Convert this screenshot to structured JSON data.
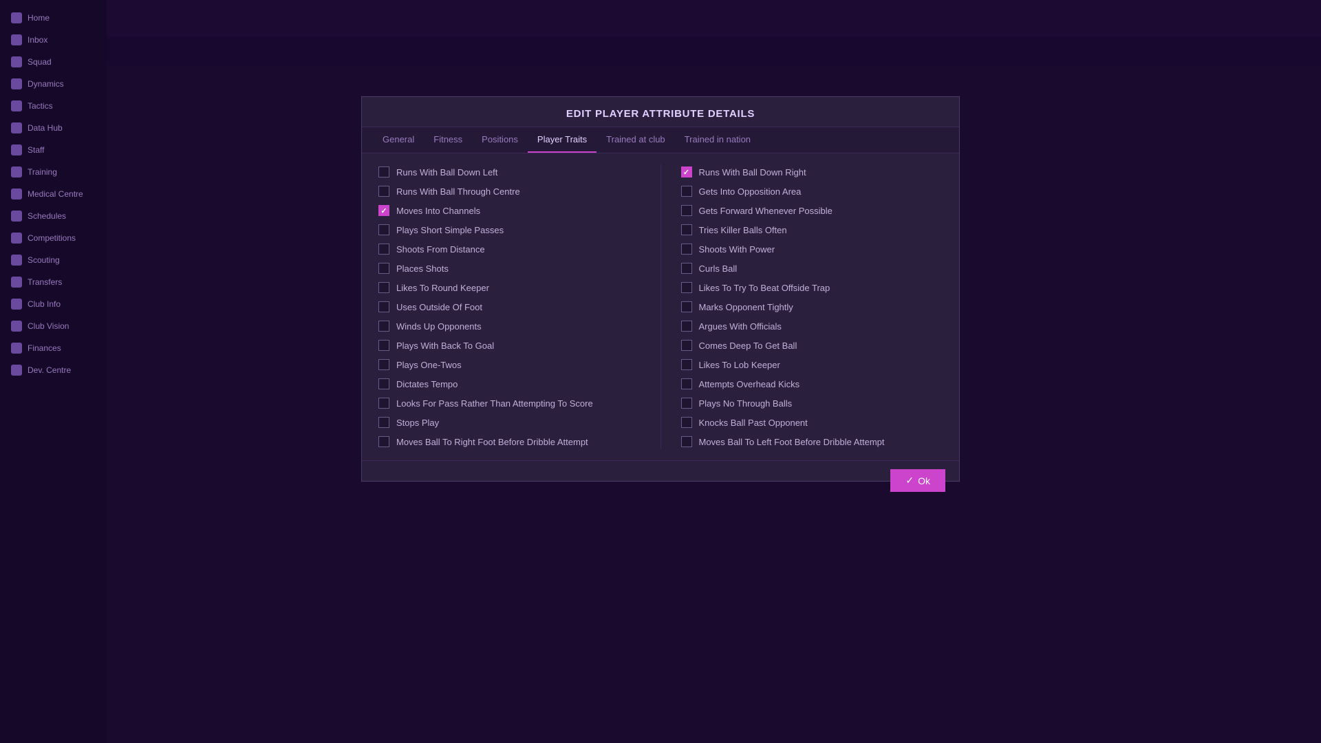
{
  "modal": {
    "title": "EDIT PLAYER ATTRIBUTE DETAILS",
    "tabs": [
      {
        "label": "General",
        "active": false
      },
      {
        "label": "Fitness",
        "active": false
      },
      {
        "label": "Positions",
        "active": false
      },
      {
        "label": "Player Traits",
        "active": true
      },
      {
        "label": "Trained at club",
        "active": false
      },
      {
        "label": "Trained in nation",
        "active": false
      }
    ],
    "ok_button": "Ok",
    "left_traits": [
      {
        "label": "Runs With Ball Down Left",
        "checked": false
      },
      {
        "label": "Runs With Ball Through Centre",
        "checked": false
      },
      {
        "label": "Moves Into Channels",
        "checked": true
      },
      {
        "label": "Plays Short Simple Passes",
        "checked": false
      },
      {
        "label": "Shoots From Distance",
        "checked": false
      },
      {
        "label": "Places Shots",
        "checked": false
      },
      {
        "label": "Likes To Round Keeper",
        "checked": false
      },
      {
        "label": "Uses Outside Of Foot",
        "checked": false
      },
      {
        "label": "Winds Up Opponents",
        "checked": false
      },
      {
        "label": "Plays With Back To Goal",
        "checked": false
      },
      {
        "label": "Plays One-Twos",
        "checked": false
      },
      {
        "label": "Dictates Tempo",
        "checked": false
      },
      {
        "label": "Looks For Pass Rather Than Attempting To Score",
        "checked": false
      },
      {
        "label": "Stops Play",
        "checked": false
      },
      {
        "label": "Moves Ball To Right Foot Before Dribble Attempt",
        "checked": false
      }
    ],
    "right_traits": [
      {
        "label": "Runs With Ball Down Right",
        "checked": true
      },
      {
        "label": "Gets Into Opposition Area",
        "checked": false
      },
      {
        "label": "Gets Forward Whenever Possible",
        "checked": false
      },
      {
        "label": "Tries Killer Balls Often",
        "checked": false
      },
      {
        "label": "Shoots With Power",
        "checked": false
      },
      {
        "label": "Curls Ball",
        "checked": false
      },
      {
        "label": "Likes To Try To Beat Offside Trap",
        "checked": false
      },
      {
        "label": "Marks Opponent Tightly",
        "checked": false
      },
      {
        "label": "Argues With Officials",
        "checked": false
      },
      {
        "label": "Comes Deep To Get Ball",
        "checked": false
      },
      {
        "label": "Likes To Lob Keeper",
        "checked": false
      },
      {
        "label": "Attempts Overhead Kicks",
        "checked": false
      },
      {
        "label": "Plays No Through Balls",
        "checked": false
      },
      {
        "label": "Knocks Ball Past Opponent",
        "checked": false
      },
      {
        "label": "Moves Ball To Left Foot Before Dribble Attempt",
        "checked": false
      }
    ]
  },
  "sidebar": {
    "items": [
      {
        "label": "Home"
      },
      {
        "label": "Inbox"
      },
      {
        "label": "Squad"
      },
      {
        "label": "Dynamics"
      },
      {
        "label": "Tactics"
      },
      {
        "label": "Data Hub"
      },
      {
        "label": "Staff"
      },
      {
        "label": "Training"
      },
      {
        "label": "Medical Centre"
      },
      {
        "label": "Schedules"
      },
      {
        "label": "Competitions"
      },
      {
        "label": "Scouting"
      },
      {
        "label": "Transfers"
      },
      {
        "label": "Club Info"
      },
      {
        "label": "Club Vision"
      },
      {
        "label": "Finances"
      },
      {
        "label": "Dev. Centre"
      }
    ]
  },
  "colors": {
    "accent": "#cc44cc",
    "checked_bg": "#cc44cc",
    "modal_bg": "#2a1f3d",
    "text_primary": "#e0d0ff",
    "text_secondary": "#c0b0d8",
    "sidebar_bg": "#150828"
  }
}
